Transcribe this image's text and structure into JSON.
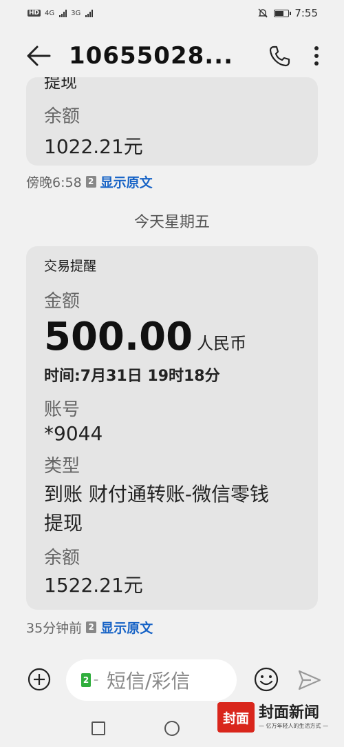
{
  "status_bar": {
    "hd": "HD",
    "net1": "4G",
    "net2": "3G",
    "time": "7:55"
  },
  "header": {
    "title": "10655028...",
    "icons": [
      "back-arrow-icon",
      "phone-icon",
      "more-vertical-icon"
    ]
  },
  "messages": [
    {
      "cut_text": "提现",
      "balance_label": "余额",
      "balance_value": "1022.21元",
      "meta_time": "傍晚6:58",
      "sim": "2",
      "show_original": "显示原文"
    }
  ],
  "date_divider": "今天星期五",
  "transaction": {
    "heading": "交易提醒",
    "amount_label": "金额",
    "amount_value": "500.00",
    "amount_unit": "人民币",
    "time_line": "时间:7月31日 19时18分",
    "account_label": "账号",
    "account_value": "*9044",
    "type_label": "类型",
    "type_value_line1": "到账 财付通转账-微信零钱",
    "type_value_line2": "提现",
    "balance_label": "余额",
    "balance_value": "1522.21元",
    "meta_time": "35分钟前",
    "sim": "2",
    "show_original": "显示原文"
  },
  "composer": {
    "sim_label": "2",
    "placeholder": "短信/彩信"
  },
  "watermark": {
    "logo": "封面",
    "name": "封面新闻",
    "slogan": "— 亿万年轻人的生活方式 —"
  },
  "colors": {
    "link": "#1763c6",
    "bubble": "#e5e5e5",
    "background": "#f1f1f1",
    "sim_green": "#2fae3c",
    "brand_red": "#d9261c"
  }
}
